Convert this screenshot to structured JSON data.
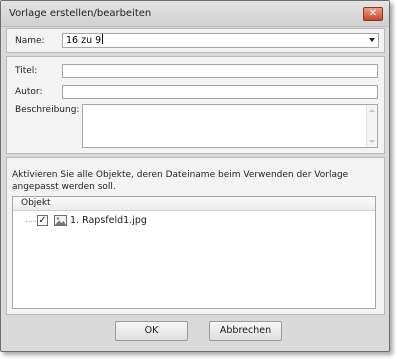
{
  "window": {
    "title": "Vorlage erstellen/bearbeiten",
    "close_symbol": "✕"
  },
  "form": {
    "name_label": "Name:",
    "name_value": "16 zu 9",
    "title_label": "Titel:",
    "title_value": "",
    "author_label": "Autor:",
    "author_value": "",
    "description_label": "Beschreibung:",
    "description_value": ""
  },
  "objects": {
    "instruction": "Aktivieren Sie alle Objekte, deren Dateiname beim Verwenden der Vorlage angepasst werden soll.",
    "column_header": "Objekt",
    "items": [
      {
        "label": "1. Rapsfeld1.jpg",
        "checked": true,
        "check_symbol": "✓",
        "icon": "image-icon"
      }
    ]
  },
  "buttons": {
    "ok": "OK",
    "cancel": "Abbrechen"
  }
}
